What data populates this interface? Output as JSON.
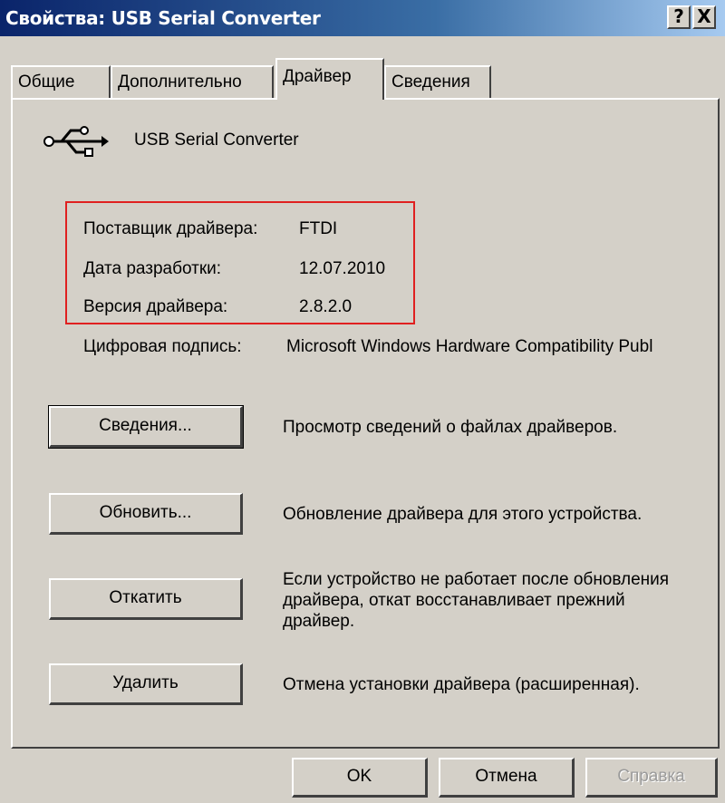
{
  "window": {
    "title": "Свойства: USB Serial Converter",
    "help_button": "?",
    "close_button": "X"
  },
  "tabs": [
    {
      "label": "Общие",
      "active": false
    },
    {
      "label": "Дополнительно",
      "active": false
    },
    {
      "label": "Драйвер",
      "active": true
    },
    {
      "label": "Сведения",
      "active": false
    }
  ],
  "device": {
    "icon": "usb-icon",
    "name": "USB Serial Converter"
  },
  "driver_info": {
    "provider_label": "Поставщик драйвера:",
    "provider_value": "FTDI",
    "date_label": "Дата разработки:",
    "date_value": "12.07.2010",
    "version_label": "Версия драйвера:",
    "version_value": "2.8.2.0",
    "signature_label": "Цифровая подпись:",
    "signature_value": "Microsoft Windows Hardware Compatibility Publ"
  },
  "actions": [
    {
      "button": "Сведения...",
      "description": "Просмотр сведений о файлах драйверов."
    },
    {
      "button": "Обновить...",
      "description": "Обновление драйвера для этого устройства."
    },
    {
      "button": "Откатить",
      "description": "Если устройство не работает после обновления драйвера, откат восстанавливает прежний драйвер."
    },
    {
      "button": "Удалить",
      "description": "Отмена установки драйвера (расширенная)."
    }
  ],
  "footer": {
    "ok": "OK",
    "cancel": "Отмена",
    "help": "Справка"
  },
  "colors": {
    "titlebar_start": "#0a246a",
    "face": "#d4d0c8",
    "highlight_box": "#e02020"
  }
}
